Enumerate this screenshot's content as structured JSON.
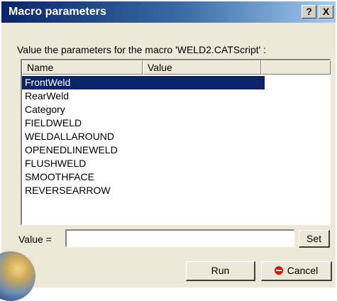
{
  "dialog": {
    "title": "Macro parameters",
    "help_label": "?",
    "close_label": "X",
    "prompt": "Value the parameters for the macro 'WELD2.CATScript' :"
  },
  "list": {
    "columns": [
      "Name",
      "Value"
    ],
    "rows": [
      {
        "name": "FrontWeld",
        "value": "",
        "selected": true
      },
      {
        "name": "RearWeld",
        "value": ""
      },
      {
        "name": "Category",
        "value": ""
      },
      {
        "name": "FIELDWELD",
        "value": ""
      },
      {
        "name": "WELDALLAROUND",
        "value": ""
      },
      {
        "name": "OPENEDLINEWELD",
        "value": ""
      },
      {
        "name": "FLUSHWELD",
        "value": ""
      },
      {
        "name": "SMOOTHFACE",
        "value": ""
      },
      {
        "name": "REVERSEARROW",
        "value": ""
      }
    ]
  },
  "value_field": {
    "label": "Value =",
    "value": ""
  },
  "buttons": {
    "set": "Set",
    "run": "Run",
    "cancel": "Cancel"
  },
  "icons": {
    "cancel": "stop-icon",
    "logo": "catia-globe-logo"
  },
  "colors": {
    "selection": "#0a246a",
    "title_bar": "#0a246a",
    "cancel_icon": "#d21a12"
  }
}
